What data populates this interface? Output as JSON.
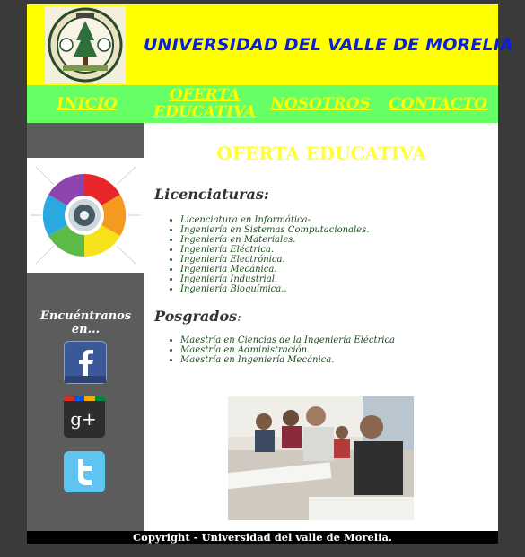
{
  "header": {
    "title": "UNIVERSIDAD DEL VALLE DE MORELIA",
    "logo_icon": "university-seal-logo"
  },
  "nav": {
    "items": [
      {
        "label": "INICIO"
      },
      {
        "label": "OFERTA EDUCATIVA"
      },
      {
        "label": "NOSOTROS"
      },
      {
        "label": "CONTACTO"
      }
    ]
  },
  "sidebar": {
    "image_icon": "color-wheel-infographic",
    "find_us": "Encuéntranos en...",
    "social": [
      {
        "icon": "facebook-icon",
        "glyph": "f",
        "color": "#3b5998"
      },
      {
        "icon": "google-plus-icon",
        "glyph": "g+",
        "color": "#2d2d2d"
      },
      {
        "icon": "twitter-icon",
        "glyph": "t",
        "color": "#5ec5f0"
      }
    ]
  },
  "content": {
    "title": "OFERTA EDUCATIVA",
    "licenciaturas_heading": "Licenciaturas:",
    "licenciaturas": [
      "Licenciatura en Informática-",
      "Ingeniería en Sistemas Computacionales.",
      "Ingeniería en Materiales.",
      "Ingeniería Eléctrica.",
      "Ingeniería Electrónica.",
      "Ingeniería Mecánica.",
      "Ingeniería Industrial.",
      "Ingeniería Bioquímica.."
    ],
    "posgrados_heading": "Posgrados",
    "posgrados_suffix": ":",
    "posgrados": [
      "Maestría en Ciencias de la Ingeniería Eléctrica",
      "Maestría en Administración.",
      "Maestría en Ingeniería Mecánica."
    ],
    "photo_icon": "classroom-students-photo"
  },
  "footer": {
    "text": "Copyright - Universidad del valle de Morelia."
  },
  "colors": {
    "header_bg": "#ffff00",
    "title": "#0b1fd6",
    "nav_bg": "#66ff66",
    "nav_text": "#ffff00",
    "sidebar_bg": "#5c5c5c",
    "list_text": "#1a4d1a"
  }
}
